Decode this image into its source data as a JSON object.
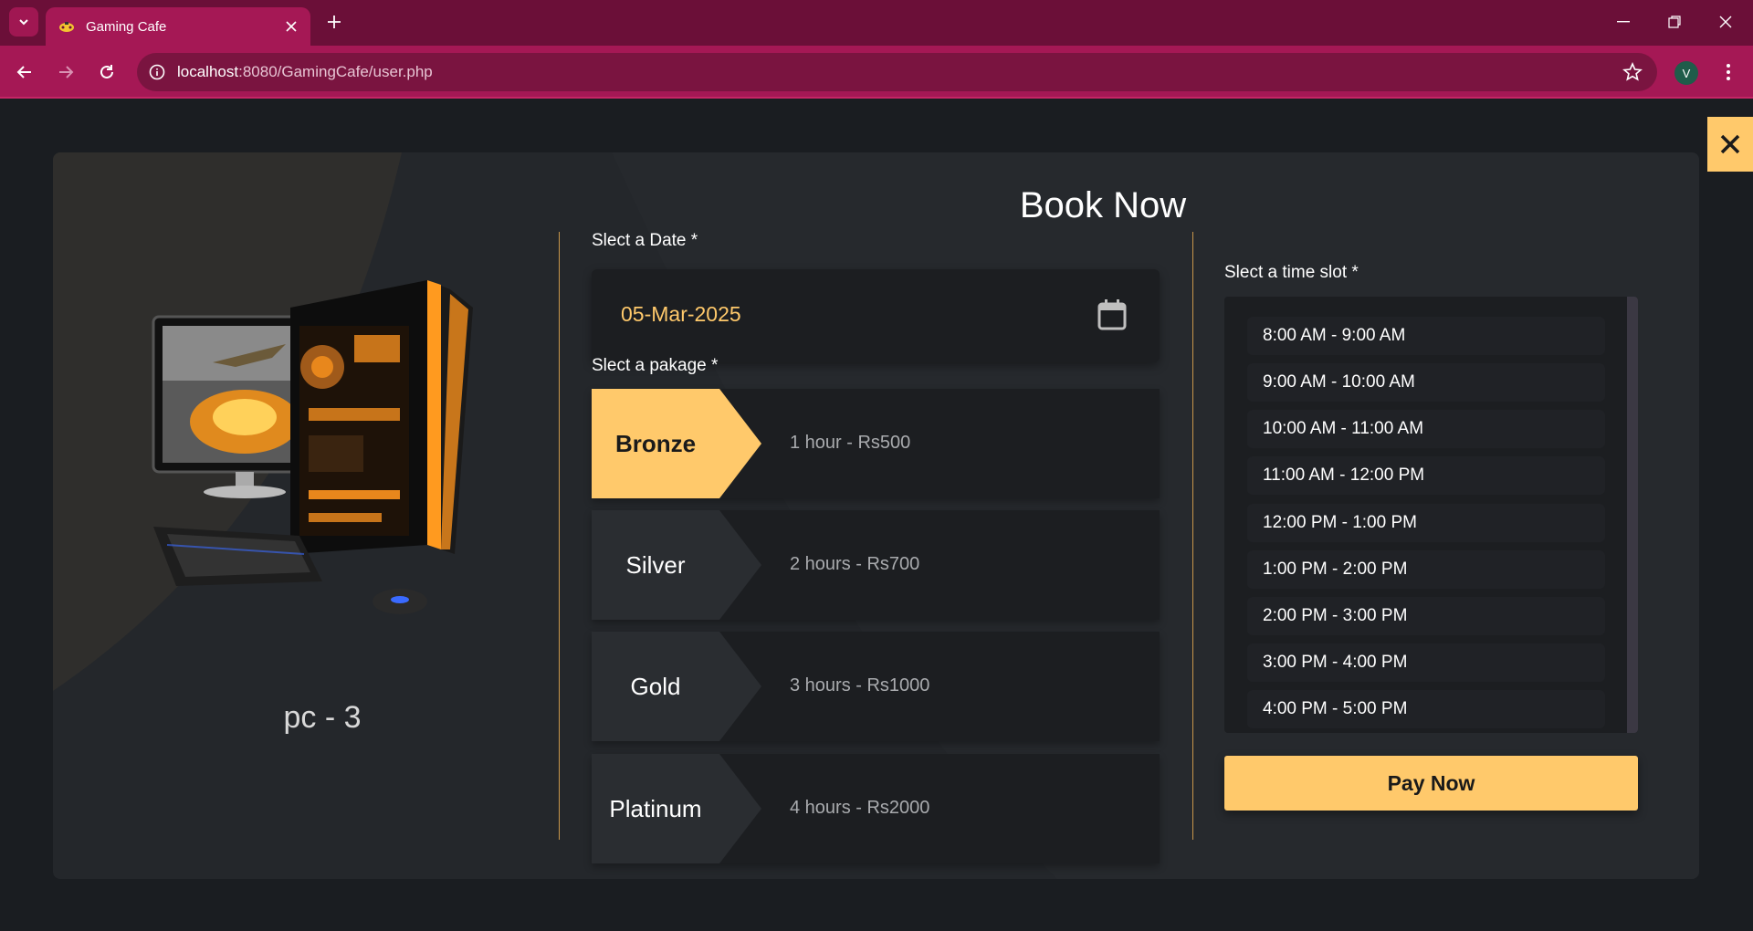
{
  "browser": {
    "tab_title": "Gaming Cafe",
    "url_host": "localhost",
    "url_path": ":8080/GamingCafe/user.php",
    "profile_initial": "V"
  },
  "icons": {
    "tab_menu": "chevron-down-icon",
    "tab_close": "close-icon",
    "new_tab": "plus-icon",
    "back": "arrow-left-icon",
    "forward": "arrow-right-icon",
    "reload": "reload-icon",
    "site_info": "info-icon",
    "bookmark": "star-icon",
    "menu": "kebab-icon",
    "modal_close": "close-icon",
    "calendar": "calendar-icon"
  },
  "pc": {
    "name": "pc - 3"
  },
  "booking": {
    "title": "Book Now",
    "date_label": "Slect a Date *",
    "date_value": "05-Mar-2025",
    "package_label": "Slect a pakage *",
    "packages": [
      {
        "name": "Bronze",
        "desc": "1 hour - Rs500",
        "selected": true
      },
      {
        "name": "Silver",
        "desc": "2 hours - Rs700",
        "selected": false
      },
      {
        "name": "Gold",
        "desc": "3 hours - Rs1000",
        "selected": false
      },
      {
        "name": "Platinum",
        "desc": "4 hours - Rs2000",
        "selected": false
      }
    ],
    "slot_label": "Slect a time slot *",
    "slots": [
      "8:00 AM - 9:00 AM",
      "9:00 AM - 10:00 AM",
      "10:00 AM - 11:00 AM",
      "11:00 AM - 12:00 PM",
      "12:00 PM - 1:00 PM",
      "1:00 PM - 2:00 PM",
      "2:00 PM - 3:00 PM",
      "3:00 PM - 4:00 PM",
      "4:00 PM - 5:00 PM"
    ],
    "pay_label": "Pay Now"
  },
  "colors": {
    "accent": "#ffc96b",
    "chrome": "#a51855",
    "background": "#1a1d21",
    "card": "#24272b"
  }
}
